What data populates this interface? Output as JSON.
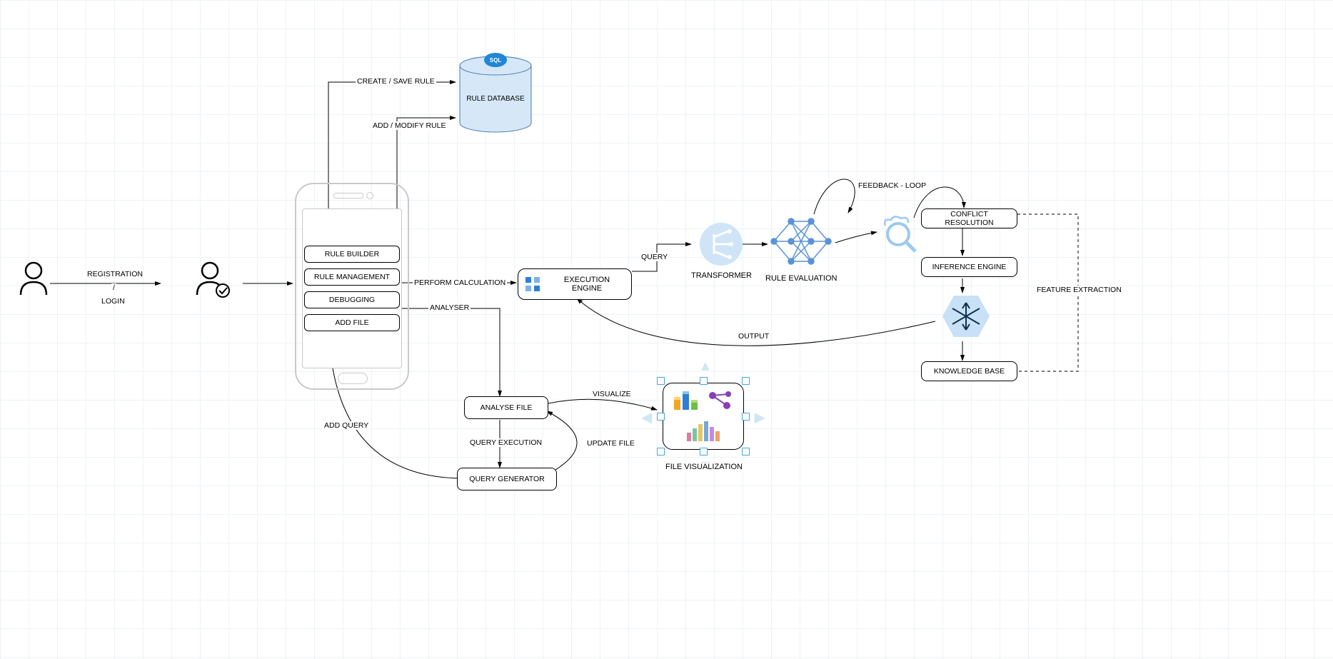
{
  "nodes": {
    "registration": "REGISTRATION",
    "login": "LOGIN",
    "slash": "/",
    "phone": {
      "rule_builder": "RULE BUILDER",
      "rule_management": "RULE MANAGEMENT",
      "debugging": "DEBUGGING",
      "add_file": "ADD FILE"
    },
    "rule_database": "RULE DATABASE",
    "execution_engine": "EXECUTION ENGINE",
    "analyse_file": "ANALYSE FILE",
    "query_generator": "QUERY GENERATOR",
    "file_visualization": "FILE VISUALIZATION",
    "transformer": "TRANSFORMER",
    "rule_evaluation": "RULE EVALUATION",
    "conflict_resolution": "CONFLICT RESOLUTION",
    "inference_engine": "INFERENCE ENGINE",
    "knowledge_base": "KNOWLEDGE BASE"
  },
  "edges": {
    "create_save_rule": "CREATE / SAVE RULE",
    "add_modify_rule": "ADD / MODIFY RULE",
    "perform_calculation": "PERFORM CALCULATION",
    "analyser": "ANALYSER",
    "add_query": "ADD QUERY",
    "query_execution": "QUERY EXECUTION",
    "update_file": "UPDATE FILE",
    "visualize": "VISUALIZE",
    "query": "QUERY",
    "output": "OUTPUT",
    "feedback_loop": "FEEDBACK - LOOP",
    "feature_extraction": "FEATURE EXTRACTION",
    "sql": "SQL"
  }
}
